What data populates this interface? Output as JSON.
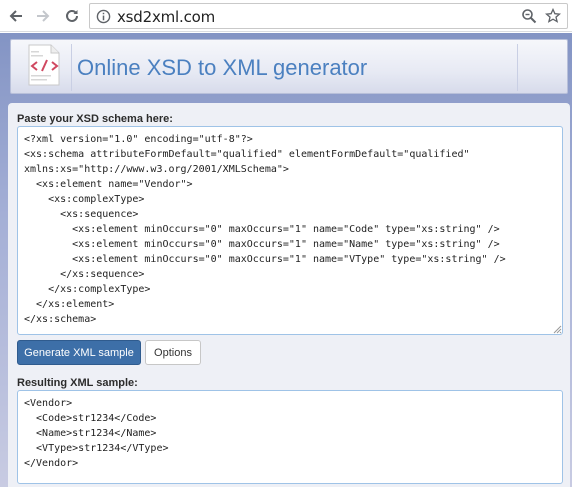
{
  "browser": {
    "url": "xsd2xml.com",
    "icons": [
      "back-arrow-icon",
      "forward-arrow-icon",
      "reload-icon",
      "info-icon",
      "zoom-icon",
      "bookmark-star-icon"
    ]
  },
  "header": {
    "title": "Online XSD to XML generator",
    "logo_icon": "xml-document-icon"
  },
  "form": {
    "xsd_label": "Paste your XSD schema here:",
    "xsd_value": "<?xml version=\"1.0\" encoding=\"utf-8\"?>\n<xs:schema attributeFormDefault=\"qualified\" elementFormDefault=\"qualified\"\nxmlns:xs=\"http://www.w3.org/2001/XMLSchema\">\n  <xs:element name=\"Vendor\">\n    <xs:complexType>\n      <xs:sequence>\n        <xs:element minOccurs=\"0\" maxOccurs=\"1\" name=\"Code\" type=\"xs:string\" />\n        <xs:element minOccurs=\"0\" maxOccurs=\"1\" name=\"Name\" type=\"xs:string\" />\n        <xs:element minOccurs=\"0\" maxOccurs=\"1\" name=\"VType\" type=\"xs:string\" />\n      </xs:sequence>\n    </xs:complexType>\n  </xs:element>\n</xs:schema>",
    "generate_label": "Generate XML sample",
    "options_label": "Options",
    "result_label": "Resulting XML sample:",
    "result_value": "<Vendor>\n  <Code>str1234</Code>\n  <Name>str1234</Name>\n  <VType>str1234</VType>\n</Vendor>"
  },
  "colors": {
    "accent": "#3d6fa8",
    "title": "#4b80c0",
    "box_border": "#9fc3e7"
  }
}
